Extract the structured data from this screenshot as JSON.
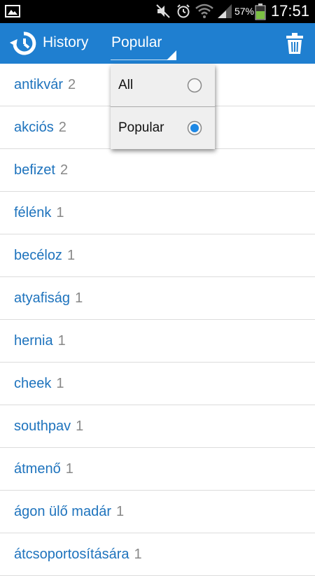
{
  "status_bar": {
    "left_icon": "image-notification-icon",
    "icons": [
      "mute-icon",
      "alarm-icon",
      "wifi-icon",
      "signal-icon",
      "battery-icon"
    ],
    "battery_percent": "57%",
    "time": "17:51"
  },
  "action_bar": {
    "color": "#1f7fd0",
    "history_label": "History",
    "filter_selected": "Popular",
    "delete_icon": "trash-icon"
  },
  "dropdown": {
    "options": [
      {
        "label": "All",
        "selected": false
      },
      {
        "label": "Popular",
        "selected": true
      }
    ],
    "accent": "#1e88e5"
  },
  "history": {
    "items": [
      {
        "word": "antikvár",
        "count": "2"
      },
      {
        "word": "akciós",
        "count": "2"
      },
      {
        "word": "befizet",
        "count": "2"
      },
      {
        "word": "félénk",
        "count": "1"
      },
      {
        "word": "becéloz",
        "count": "1"
      },
      {
        "word": "atyafiság",
        "count": "1"
      },
      {
        "word": "hernia",
        "count": "1"
      },
      {
        "word": "cheek",
        "count": "1"
      },
      {
        "word": "southpav",
        "count": "1"
      },
      {
        "word": "átmenő",
        "count": "1"
      },
      {
        "word": "ágon ülő madár",
        "count": "1"
      },
      {
        "word": "átcsoportosítására",
        "count": "1"
      }
    ]
  }
}
